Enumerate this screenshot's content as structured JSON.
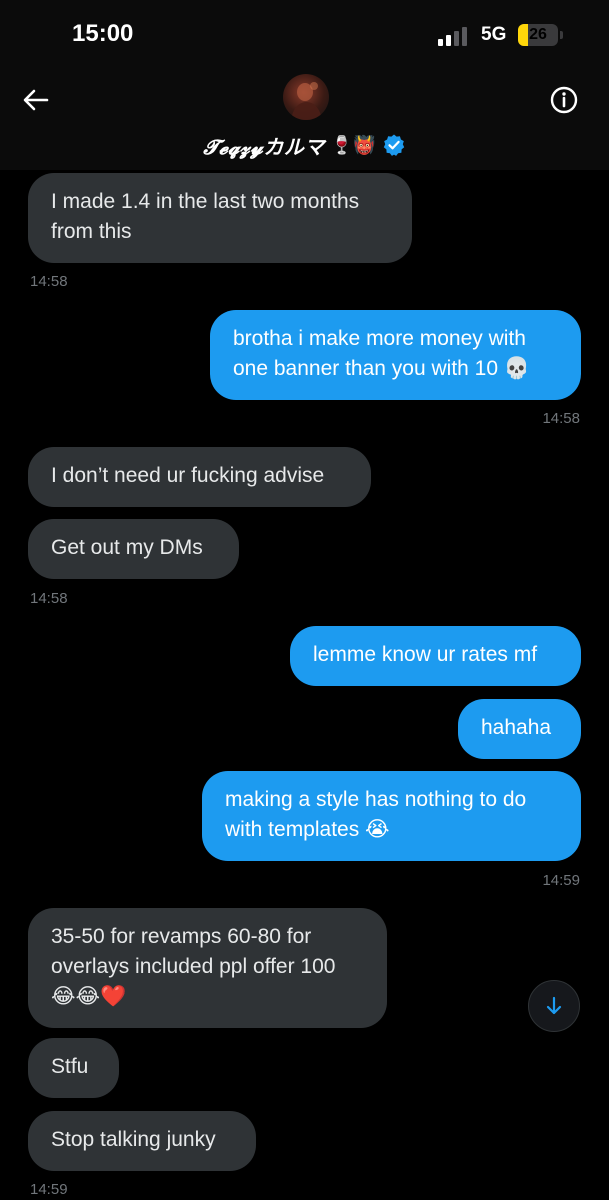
{
  "status_bar": {
    "time": "15:00",
    "network": "5G",
    "battery_percent": 26,
    "battery_label": "26",
    "signal_bars_active": 2,
    "signal_bars_total": 4
  },
  "header": {
    "contact_name": "𝓣𝓮𝓺𝔃𝔂カルマ",
    "name_emojis": "🍷👹",
    "verified": true,
    "back_icon": "arrow-left-icon",
    "info_icon": "info-circle-icon",
    "colors": {
      "verified_badge": "#1d9bf0"
    }
  },
  "messages": [
    {
      "sender": "them",
      "text": "I made 1.4 in the last two months\nfrom this"
    },
    {
      "sender": "me",
      "text": "brotha i make more money with\none banner than you with 10 💀"
    },
    {
      "sender": "them",
      "text": "I don’t need ur fucking advise"
    },
    {
      "sender": "them",
      "text": "Get out my DMs"
    },
    {
      "sender": "me",
      "text": "lemme know ur rates mf"
    },
    {
      "sender": "me",
      "text": "hahaha"
    },
    {
      "sender": "me",
      "text": "making a style has nothing to do\nwith templates 😭"
    },
    {
      "sender": "them",
      "text": "35-50 for revamps 60-80 for\noverlays included ppl offer 100\n😂😂❤️"
    },
    {
      "sender": "them",
      "text": "Stfu"
    },
    {
      "sender": "them",
      "text": "Stop talking junky"
    }
  ],
  "timestamps": [
    "14:58",
    "14:58",
    "14:58",
    "14:59",
    "14:59"
  ],
  "scroll_button": {
    "icon": "arrow-down-icon"
  },
  "colors": {
    "background": "#000000",
    "incoming_bubble": "#2f3336",
    "outgoing_bubble": "#1d9bf0",
    "timestamp": "#71767b",
    "battery": "#ffd60a"
  }
}
